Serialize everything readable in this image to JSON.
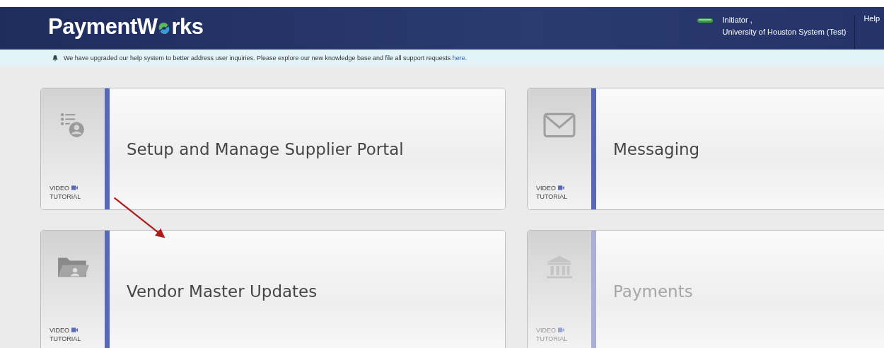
{
  "header": {
    "logo": {
      "before": "PaymentW",
      "after": "rks"
    },
    "user": {
      "role": "Initiator ,",
      "organization": "University of Houston System (Test)"
    },
    "help": "Help"
  },
  "notice": {
    "text": "We have upgraded our help system to better address user inquiries. Please explore our new knowledge base and file all support requests ",
    "link": "here",
    "end": "."
  },
  "tiles": [
    {
      "kind": "supplier",
      "title": "Setup and Manage Supplier Portal",
      "video_label": [
        "VIDEO",
        "TUTORIAL"
      ],
      "disabled": false
    },
    {
      "kind": "messaging",
      "title": "Messaging",
      "video_label": [
        "VIDEO",
        "TUTORIAL"
      ],
      "disabled": false
    },
    {
      "kind": "vendor",
      "title": "Vendor Master Updates",
      "video_label": [
        "VIDEO",
        "TUTORIAL"
      ],
      "disabled": false
    },
    {
      "kind": "payments",
      "title": "Payments",
      "video_label": [
        "VIDEO",
        "TUTORIAL"
      ],
      "disabled": true
    }
  ]
}
